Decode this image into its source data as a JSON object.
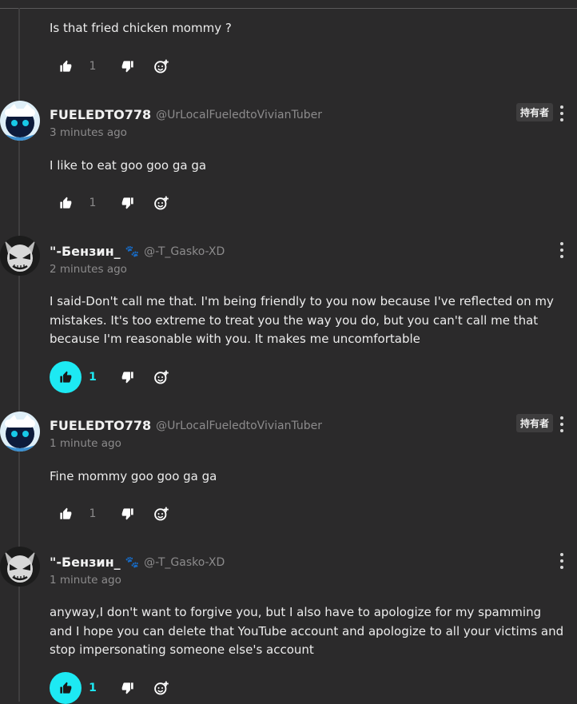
{
  "first_comment": {
    "text": "Is that fried chicken mommy ?",
    "likes": "1"
  },
  "comments": [
    {
      "author": "FUELEDTO778",
      "handle": "@UrLocalFueledtoVivianTuber",
      "time": "3 minutes ago",
      "badge": "持有者",
      "text": "I like to eat goo goo ga ga",
      "likes": "1",
      "liked": false,
      "avatar": "cat-avatar"
    },
    {
      "author": "\"-Бензин_",
      "handle": "@-T_Gasko-XD",
      "time": "2 minutes ago",
      "text": "I said-Don't call me that. I'm being friendly to you now because I've reflected on my mistakes. It's too extreme to treat you the way you do, but you can't call me that because I'm reasonable with you. It makes me uncomfortable",
      "likes": "1",
      "liked": true,
      "avatar": "mask-avatar"
    },
    {
      "author": "FUELEDTO778",
      "handle": "@UrLocalFueledtoVivianTuber",
      "time": "1 minute ago",
      "badge": "持有者",
      "text": "Fine mommy goo goo ga ga",
      "likes": "1",
      "liked": false,
      "avatar": "cat-avatar"
    },
    {
      "author": "\"-Бензин_",
      "handle": "@-T_Gasko-XD",
      "time": "1 minute ago",
      "text": "anyway,I don't want to forgive you, but I also have to apologize for my spamming and I hope you can delete that YouTube account and apologize to all your victims and stop impersonating someone else's account",
      "likes": "1",
      "liked": true,
      "avatar": "mask-avatar"
    }
  ],
  "colors": {
    "background": "#2b2a2b",
    "accent_like": "#1de9f3",
    "muted_text": "#8c8b8c"
  },
  "icons": [
    "thumbs-up-icon",
    "thumbs-down-icon",
    "reply-icon",
    "more-options-icon",
    "paw-icon"
  ]
}
